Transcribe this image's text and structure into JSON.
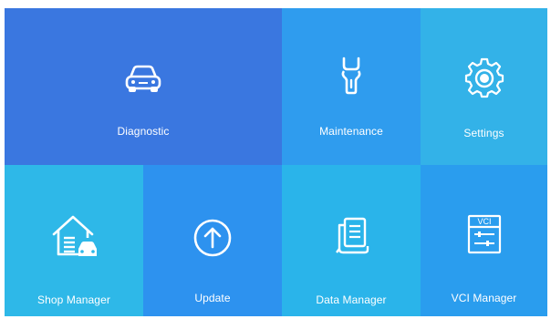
{
  "tiles": {
    "diagnostic": {
      "label": "Diagnostic",
      "icon": "car-icon"
    },
    "maintenance": {
      "label": "Maintenance",
      "icon": "wrench-icon"
    },
    "settings": {
      "label": "Settings",
      "icon": "gear-icon"
    },
    "shop_manager": {
      "label": "Shop Manager",
      "icon": "garage-icon"
    },
    "update": {
      "label": "Update",
      "icon": "upload-arrow-icon"
    },
    "data_manager": {
      "label": "Data Manager",
      "icon": "documents-icon"
    },
    "vci_manager": {
      "label": "VCI Manager",
      "icon": "vci-device-icon",
      "badge": "VCI"
    }
  },
  "colors": {
    "diagnostic": "#3a77e0",
    "maintenance": "#2f9cee",
    "settings": "#33b2e8",
    "shop_manager": "#2eb8e8",
    "update": "#2d92ef",
    "data_manager": "#2ab4ea",
    "vci_manager": "#2a9dee"
  }
}
